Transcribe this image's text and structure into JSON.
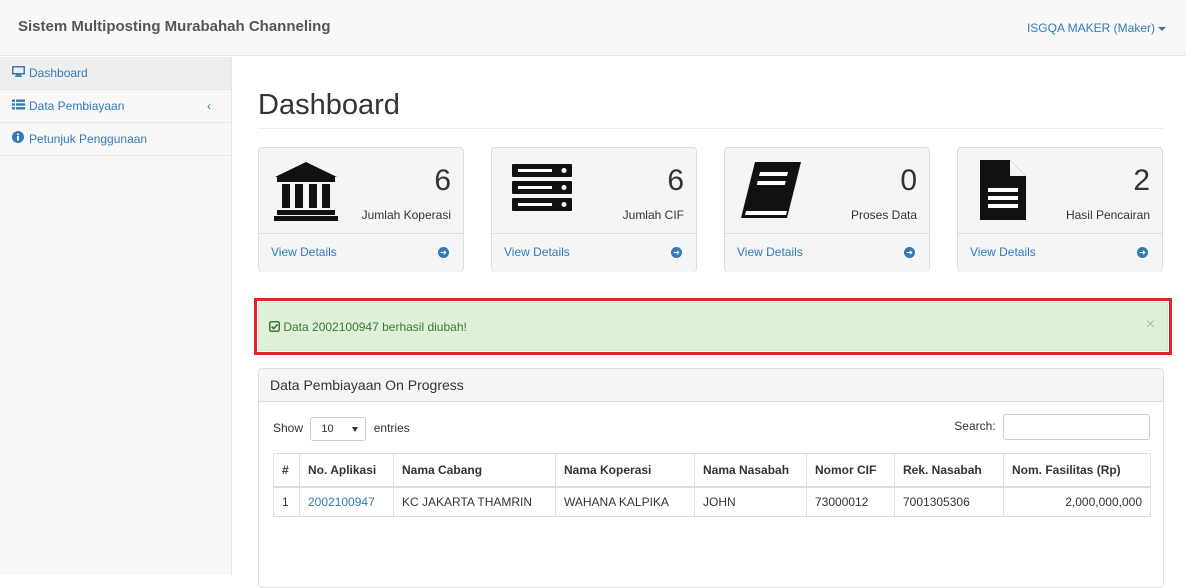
{
  "app": {
    "title": "Sistem Multiposting Murabahah Channeling",
    "user_label": "ISGQA MAKER (Maker)"
  },
  "sidebar": {
    "items": [
      {
        "label": "Dashboard",
        "icon": "monitor-icon"
      },
      {
        "label": "Data Pembiayaan",
        "icon": "list-icon",
        "chevron": "‹"
      },
      {
        "label": "Petunjuk Penggunaan",
        "icon": "info-circle-icon"
      }
    ]
  },
  "main": {
    "title": "Dashboard",
    "stats": [
      {
        "value": "6",
        "label": "Jumlah Koperasi",
        "link": "View Details",
        "icon": "bank-icon"
      },
      {
        "value": "6",
        "label": "Jumlah CIF",
        "link": "View Details",
        "icon": "server-icon"
      },
      {
        "value": "0",
        "label": "Proses Data",
        "link": "View Details",
        "icon": "book-icon"
      },
      {
        "value": "2",
        "label": "Hasil Pencairan",
        "link": "View Details",
        "icon": "file-text-icon"
      }
    ],
    "alert": {
      "message": "Data 2002100947 berhasil diubah!",
      "close": "×"
    },
    "table_panel": {
      "heading": "Data Pembiayaan On Progress",
      "show_label": "Show",
      "entries_value": "10",
      "entries_label": "entries",
      "search_label": "Search:",
      "columns": [
        "#",
        "No. Aplikasi",
        "Nama Cabang",
        "Nama Koperasi",
        "Nama Nasabah",
        "Nomor CIF",
        "Rek. Nasabah",
        "Nom. Fasilitas (Rp)"
      ],
      "rows": [
        [
          "1",
          "2002100947",
          "KC JAKARTA THAMRIN",
          "WAHANA KALPIKA",
          "JOHN",
          "73000012",
          "7001305306",
          "2,000,000,000"
        ]
      ]
    }
  },
  "colors": {
    "link": "#337ab7",
    "alert_bg": "#dff0d8",
    "alert_text": "#3c763d",
    "highlight_border": "#d8262b"
  }
}
